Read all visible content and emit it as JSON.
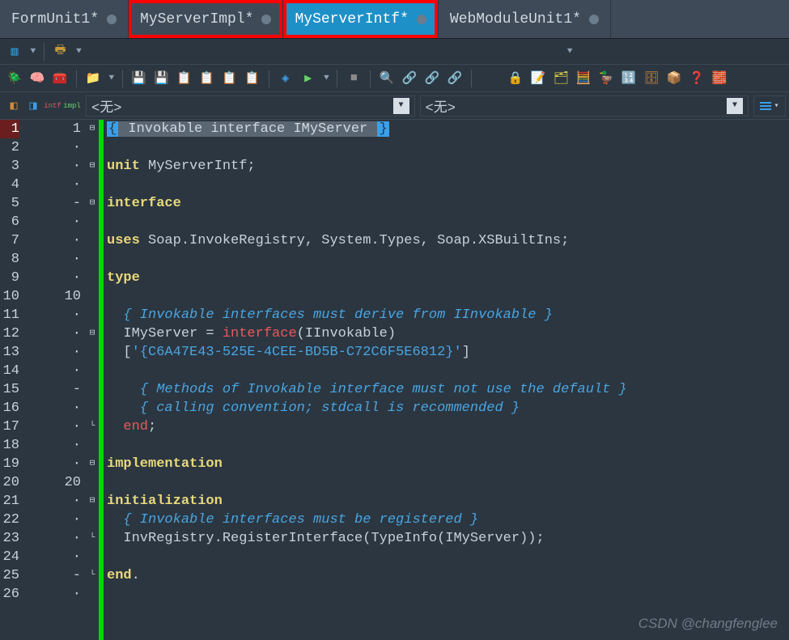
{
  "tabs": [
    {
      "label": "FormUnit1*",
      "active": false,
      "highlight": false
    },
    {
      "label": "MyServerImpl*",
      "active": false,
      "highlight": true
    },
    {
      "label": "MyServerIntf*",
      "active": true,
      "highlight": true
    },
    {
      "label": "WebModuleUnit1*",
      "active": false,
      "highlight": false
    }
  ],
  "toolbar_rows": {
    "row1_icons": [
      "🧩",
      "⯆",
      "🖨",
      "⯆"
    ],
    "row2_left": [
      "🪲",
      "🧠",
      "🧰",
      "📁",
      "💾",
      "💾",
      "📋",
      "📋",
      "📋",
      "📋",
      "◈",
      "▶",
      "■",
      "🔍",
      "🔗",
      "🔗",
      "🔗"
    ],
    "row2_right": [
      "🔒",
      "📝",
      "🗂",
      "🧮",
      "🦆",
      "🔢",
      "🗄",
      "📦",
      "❓",
      "🧱"
    ]
  },
  "dropdowns": {
    "left": "<无>",
    "right": "<无>"
  },
  "editor": {
    "current_line": 1,
    "lines": [
      {
        "num": 1,
        "rel": "1",
        "fold": "⊟",
        "html": "<span class='brace-l'>{</span><span class='hl'> Invokable interface IMyServer </span><span class='brace-r'>}</span>"
      },
      {
        "num": 2,
        "rel": "·",
        "fold": "",
        "html": ""
      },
      {
        "num": 3,
        "rel": "·",
        "fold": "⊟",
        "html": "<span class='kw'>unit</span><span class='plain'> MyServerIntf;</span>"
      },
      {
        "num": 4,
        "rel": "·",
        "fold": "",
        "html": ""
      },
      {
        "num": 5,
        "rel": "-",
        "fold": "⊟",
        "html": "<span class='kw'>interface</span>"
      },
      {
        "num": 6,
        "rel": "·",
        "fold": "",
        "html": ""
      },
      {
        "num": 7,
        "rel": "·",
        "fold": "",
        "html": "<span class='kw'>uses</span><span class='plain'> Soap.InvokeRegistry, System.Types, Soap.XSBuiltIns;</span>"
      },
      {
        "num": 8,
        "rel": "·",
        "fold": "",
        "html": ""
      },
      {
        "num": 9,
        "rel": "·",
        "fold": "",
        "html": "<span class='kw'>type</span>"
      },
      {
        "num": 10,
        "rel": "10",
        "fold": "",
        "html": ""
      },
      {
        "num": 11,
        "rel": "·",
        "fold": "",
        "html": "  <span class='cm'>{ Invokable interfaces must derive from IInvokable }</span>"
      },
      {
        "num": 12,
        "rel": "·",
        "fold": "⊟",
        "html": "  <span class='plain'>IMyServer = </span><span class='redkw'>interface</span><span class='plain'>(IInvokable)</span>"
      },
      {
        "num": 13,
        "rel": "·",
        "fold": "",
        "html": "  <span class='plain'>[</span><span class='str'>'{C6A47E43-525E-4CEE-BD5B-C72C6F5E6812}'</span><span class='plain'>]</span>"
      },
      {
        "num": 14,
        "rel": "·",
        "fold": "",
        "html": ""
      },
      {
        "num": 15,
        "rel": "-",
        "fold": "",
        "html": "    <span class='cm'>{ Methods of Invokable interface must not use the default }</span>"
      },
      {
        "num": 16,
        "rel": "·",
        "fold": "",
        "html": "    <span class='cm'>{ calling convention; stdcall is recommended }</span>"
      },
      {
        "num": 17,
        "rel": "·",
        "fold": "└",
        "html": "  <span class='redkw'>end</span><span class='plain'>;</span>"
      },
      {
        "num": 18,
        "rel": "·",
        "fold": "",
        "html": ""
      },
      {
        "num": 19,
        "rel": "·",
        "fold": "⊟",
        "html": "<span class='kw'>implementation</span>"
      },
      {
        "num": 20,
        "rel": "20",
        "fold": "",
        "html": ""
      },
      {
        "num": 21,
        "rel": "·",
        "fold": "⊟",
        "html": "<span class='kw'>initialization</span>"
      },
      {
        "num": 22,
        "rel": "·",
        "fold": "",
        "html": "  <span class='cm'>{ Invokable interfaces must be registered }</span>"
      },
      {
        "num": 23,
        "rel": "·",
        "fold": "└",
        "html": "  <span class='plain'>InvRegistry.RegisterInterface(TypeInfo(IMyServer));</span>"
      },
      {
        "num": 24,
        "rel": "·",
        "fold": "",
        "html": ""
      },
      {
        "num": 25,
        "rel": "-",
        "fold": "└",
        "html": "<span class='kw'>end</span><span class='plain'>.</span>"
      },
      {
        "num": 26,
        "rel": "·",
        "fold": "",
        "html": ""
      }
    ]
  },
  "watermark": "CSDN @changfenglee"
}
